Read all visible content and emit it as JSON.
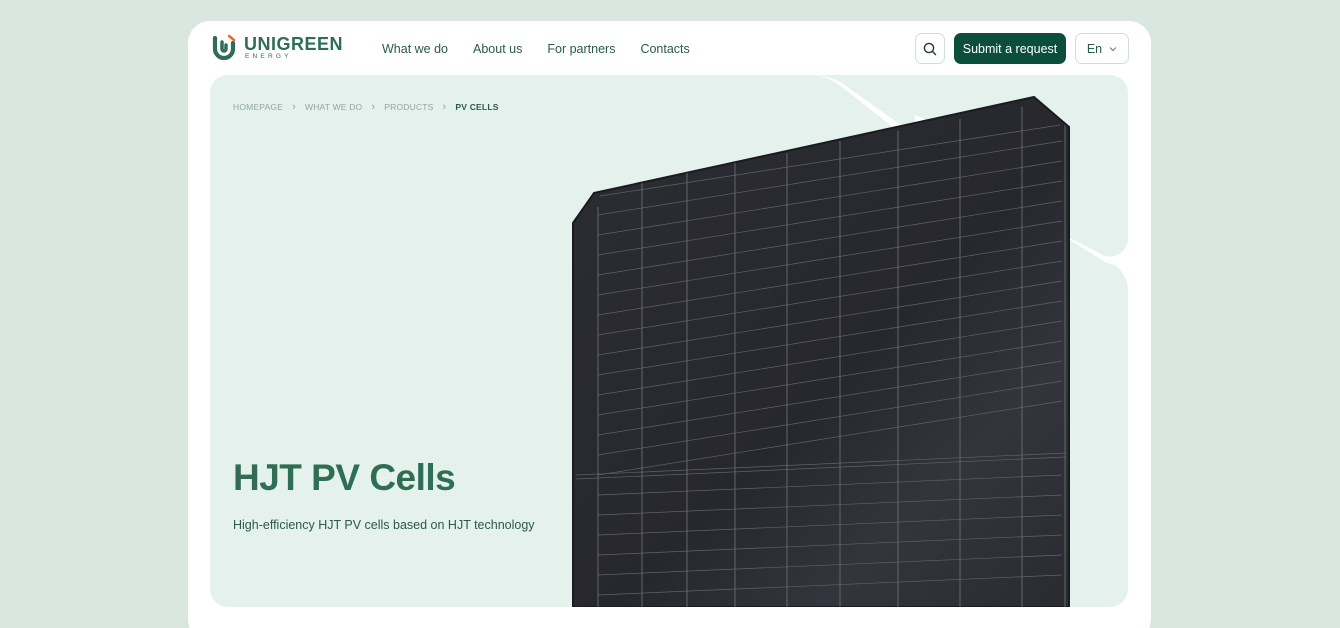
{
  "brand": {
    "name": "UNIGREEN",
    "sub": "ENERGY",
    "green": "#2f6e55",
    "dark_green": "#0b4f3a",
    "accent_orange": "#e8672c"
  },
  "nav": {
    "items": [
      {
        "label": "What we do"
      },
      {
        "label": "About us"
      },
      {
        "label": "For partners"
      },
      {
        "label": "Contacts"
      }
    ]
  },
  "header": {
    "search_icon": "search-icon",
    "submit_label": "Submit a request",
    "language": "En",
    "language_icon": "chevron-down-icon"
  },
  "breadcrumb": {
    "items": [
      {
        "label": "HOMEPAGE"
      },
      {
        "label": "WHAT WE DO"
      },
      {
        "label": "PRODUCTS"
      },
      {
        "label": "PV CELLS"
      }
    ],
    "separator_icon": "chevron-right-icon"
  },
  "hero": {
    "title": "HJT PV Cells",
    "subtitle": "High-efficiency HJT PV cells based on HJT technology",
    "image": "solar-panel-image",
    "bg_color": "#e4f1ec"
  }
}
